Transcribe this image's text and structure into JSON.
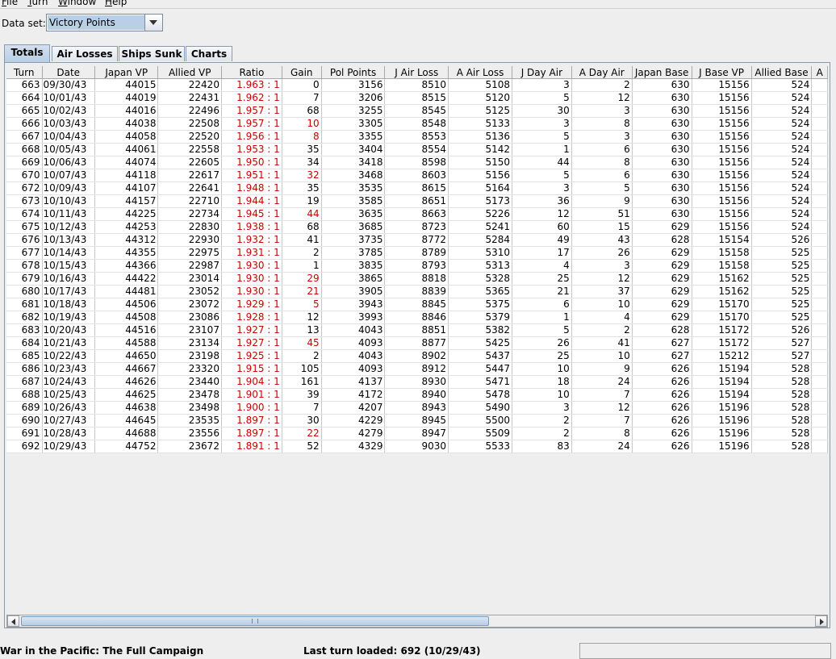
{
  "menu": [
    "File",
    "Turn",
    "Window",
    "Help"
  ],
  "dataset": {
    "label": "Data set:",
    "value": "Victory Points"
  },
  "tabs": [
    "Totals",
    "Air Losses",
    "Ships Sunk",
    "Charts"
  ],
  "table": {
    "columns": [
      "Turn",
      "Date",
      "Japan VP",
      "Allied VP",
      "Ratio",
      "Gain",
      "Pol Points",
      "J Air Loss",
      "A Air Loss",
      "J Day Air",
      "A Day Air",
      "Japan Base",
      "J Base VP",
      "Allied Base",
      "A"
    ],
    "rows": [
      [
        "663",
        "09/30/43",
        "44015",
        "22420",
        "1.963 : 1",
        "0",
        "3156",
        "8510",
        "5108",
        "3",
        "2",
        "630",
        "15156",
        "524"
      ],
      [
        "664",
        "10/01/43",
        "44019",
        "22431",
        "1.962 : 1",
        "7",
        "3206",
        "8515",
        "5120",
        "5",
        "12",
        "630",
        "15156",
        "524"
      ],
      [
        "665",
        "10/02/43",
        "44016",
        "22496",
        "1.957 : 1",
        "68",
        "3255",
        "8545",
        "5125",
        "30",
        "3",
        "630",
        "15156",
        "524"
      ],
      [
        "666",
        "10/03/43",
        "44038",
        "22508",
        "1.957 : 1",
        "10",
        "3305",
        "8548",
        "5133",
        "3",
        "8",
        "630",
        "15156",
        "524"
      ],
      [
        "667",
        "10/04/43",
        "44058",
        "22520",
        "1.956 : 1",
        "8",
        "3355",
        "8553",
        "5136",
        "5",
        "3",
        "630",
        "15156",
        "524"
      ],
      [
        "668",
        "10/05/43",
        "44061",
        "22558",
        "1.953 : 1",
        "35",
        "3404",
        "8554",
        "5142",
        "1",
        "6",
        "630",
        "15156",
        "524"
      ],
      [
        "669",
        "10/06/43",
        "44074",
        "22605",
        "1.950 : 1",
        "34",
        "3418",
        "8598",
        "5150",
        "44",
        "8",
        "630",
        "15156",
        "524"
      ],
      [
        "670",
        "10/07/43",
        "44118",
        "22617",
        "1.951 : 1",
        "32",
        "3468",
        "8603",
        "5156",
        "5",
        "6",
        "630",
        "15156",
        "524"
      ],
      [
        "672",
        "10/09/43",
        "44107",
        "22641",
        "1.948 : 1",
        "35",
        "3535",
        "8615",
        "5164",
        "3",
        "5",
        "630",
        "15156",
        "524"
      ],
      [
        "673",
        "10/10/43",
        "44157",
        "22710",
        "1.944 : 1",
        "19",
        "3585",
        "8651",
        "5173",
        "36",
        "9",
        "630",
        "15156",
        "524"
      ],
      [
        "674",
        "10/11/43",
        "44225",
        "22734",
        "1.945 : 1",
        "44",
        "3635",
        "8663",
        "5226",
        "12",
        "51",
        "630",
        "15156",
        "524"
      ],
      [
        "675",
        "10/12/43",
        "44253",
        "22830",
        "1.938 : 1",
        "68",
        "3685",
        "8723",
        "5241",
        "60",
        "15",
        "629",
        "15156",
        "524"
      ],
      [
        "676",
        "10/13/43",
        "44312",
        "22930",
        "1.932 : 1",
        "41",
        "3735",
        "8772",
        "5284",
        "49",
        "43",
        "628",
        "15154",
        "526"
      ],
      [
        "677",
        "10/14/43",
        "44355",
        "22975",
        "1.931 : 1",
        "2",
        "3785",
        "8789",
        "5310",
        "17",
        "26",
        "629",
        "15158",
        "525"
      ],
      [
        "678",
        "10/15/43",
        "44366",
        "22987",
        "1.930 : 1",
        "1",
        "3835",
        "8793",
        "5313",
        "4",
        "3",
        "629",
        "15158",
        "525"
      ],
      [
        "679",
        "10/16/43",
        "44422",
        "23014",
        "1.930 : 1",
        "29",
        "3865",
        "8818",
        "5328",
        "25",
        "12",
        "629",
        "15162",
        "525"
      ],
      [
        "680",
        "10/17/43",
        "44481",
        "23052",
        "1.930 : 1",
        "21",
        "3905",
        "8839",
        "5365",
        "21",
        "37",
        "629",
        "15162",
        "525"
      ],
      [
        "681",
        "10/18/43",
        "44506",
        "23072",
        "1.929 : 1",
        "5",
        "3943",
        "8845",
        "5375",
        "6",
        "10",
        "629",
        "15170",
        "525"
      ],
      [
        "682",
        "10/19/43",
        "44508",
        "23086",
        "1.928 : 1",
        "12",
        "3993",
        "8846",
        "5379",
        "1",
        "4",
        "629",
        "15170",
        "525"
      ],
      [
        "683",
        "10/20/43",
        "44516",
        "23107",
        "1.927 : 1",
        "13",
        "4043",
        "8851",
        "5382",
        "5",
        "2",
        "628",
        "15172",
        "526"
      ],
      [
        "684",
        "10/21/43",
        "44588",
        "23134",
        "1.927 : 1",
        "45",
        "4093",
        "8877",
        "5425",
        "26",
        "41",
        "627",
        "15172",
        "527"
      ],
      [
        "685",
        "10/22/43",
        "44650",
        "23198",
        "1.925 : 1",
        "2",
        "4043",
        "8902",
        "5437",
        "25",
        "10",
        "627",
        "15212",
        "527"
      ],
      [
        "686",
        "10/23/43",
        "44667",
        "23320",
        "1.915 : 1",
        "105",
        "4093",
        "8912",
        "5447",
        "10",
        "9",
        "626",
        "15194",
        "528"
      ],
      [
        "687",
        "10/24/43",
        "44626",
        "23440",
        "1.904 : 1",
        "161",
        "4137",
        "8930",
        "5471",
        "18",
        "24",
        "626",
        "15194",
        "528"
      ],
      [
        "688",
        "10/25/43",
        "44625",
        "23478",
        "1.901 : 1",
        "39",
        "4172",
        "8940",
        "5478",
        "10",
        "7",
        "626",
        "15194",
        "528"
      ],
      [
        "689",
        "10/26/43",
        "44638",
        "23498",
        "1.900 : 1",
        "7",
        "4207",
        "8943",
        "5490",
        "3",
        "12",
        "626",
        "15196",
        "528"
      ],
      [
        "690",
        "10/27/43",
        "44645",
        "23535",
        "1.897 : 1",
        "30",
        "4229",
        "8945",
        "5500",
        "2",
        "7",
        "626",
        "15196",
        "528"
      ],
      [
        "691",
        "10/28/43",
        "44688",
        "23556",
        "1.897 : 1",
        "22",
        "4279",
        "8947",
        "5509",
        "2",
        "8",
        "626",
        "15196",
        "528"
      ],
      [
        "692",
        "10/29/43",
        "44752",
        "23672",
        "1.891 : 1",
        "52",
        "4329",
        "9030",
        "5533",
        "83",
        "24",
        "626",
        "15196",
        "528"
      ]
    ],
    "red_gain_rows": [
      3,
      4,
      7,
      10,
      15,
      16,
      17,
      20,
      27
    ]
  },
  "status": {
    "campaign": "War in the Pacific: The Full Campaign",
    "last_turn": "Last turn loaded: 692 (10/29/43)"
  },
  "colors": {
    "ratio_text": "#cc0000",
    "selection": "#b8cfe5"
  }
}
